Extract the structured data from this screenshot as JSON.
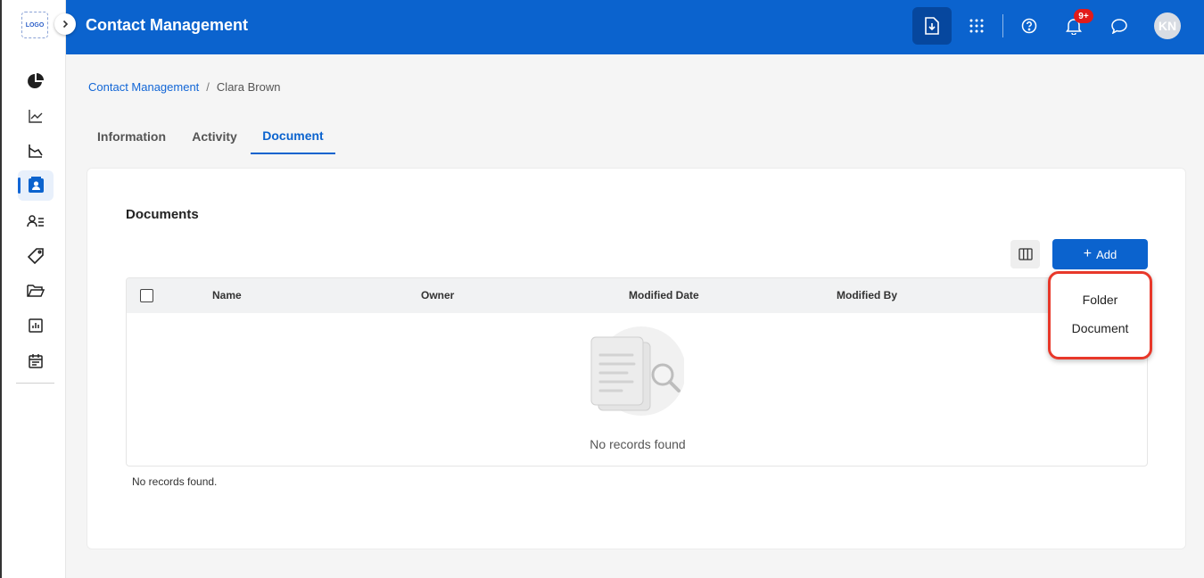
{
  "logo": {
    "text": "LOGO"
  },
  "header": {
    "title": "Contact Management",
    "notification_badge": "9+",
    "avatar_initials": "KN",
    "icons": [
      "download-file-icon",
      "apps-grid-icon",
      "help-icon",
      "bell-icon",
      "chat-icon"
    ]
  },
  "sidebar": {
    "items": [
      {
        "icon": "pie-chart-icon",
        "active": false
      },
      {
        "icon": "line-chart-icon",
        "active": false
      },
      {
        "icon": "area-chart-icon",
        "active": false
      },
      {
        "icon": "contact-card-icon",
        "active": true
      },
      {
        "icon": "person-list-icon",
        "active": false
      },
      {
        "icon": "tag-icon",
        "active": false
      },
      {
        "icon": "folder-open-icon",
        "active": false
      },
      {
        "icon": "report-icon",
        "active": false
      },
      {
        "icon": "calendar-icon",
        "active": false
      }
    ]
  },
  "breadcrumb": {
    "parent": "Contact Management",
    "separator": "/",
    "current": "Clara Brown"
  },
  "tabs": [
    {
      "label": "Information",
      "active": false
    },
    {
      "label": "Activity",
      "active": false
    },
    {
      "label": "Document",
      "active": true
    }
  ],
  "documents": {
    "title": "Documents",
    "add_label": "Add",
    "add_icon": "+",
    "columns": [
      "Name",
      "Owner",
      "Modified Date",
      "Modified By"
    ],
    "rows": [],
    "empty_text": "No records found",
    "footer_text": "No records found."
  },
  "dropdown": {
    "items": [
      "Folder",
      "Document"
    ]
  },
  "colors": {
    "primary": "#0b63ce",
    "header_active": "#06479e",
    "highlight": "#e8382a",
    "badge": "#e11b1b"
  }
}
